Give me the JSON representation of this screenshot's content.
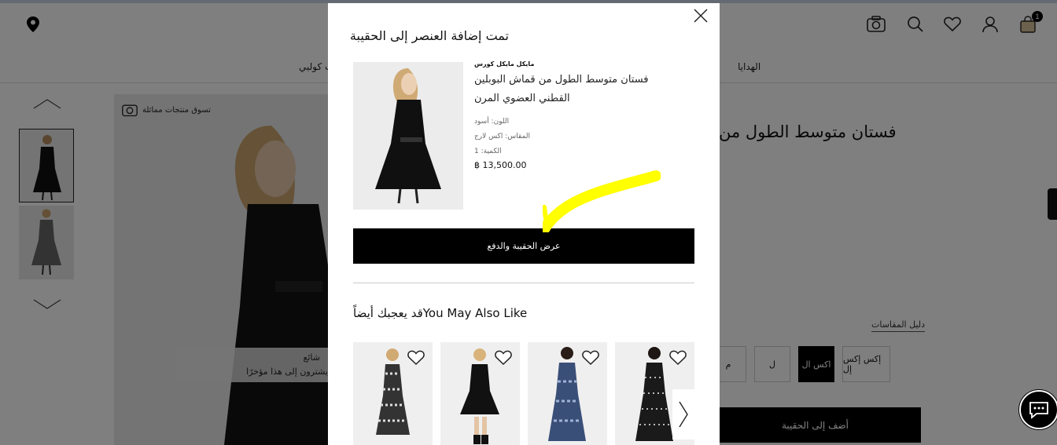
{
  "header": {
    "icons": [
      "location-icon",
      "visual-search-icon",
      "search-icon",
      "wishlist-icon",
      "account-icon",
      "bag-icon"
    ],
    "bag_count": "1"
  },
  "nav": {
    "items": [
      "الهدايا",
      "ب كولبي"
    ]
  },
  "gallery": {
    "shop_similar": "تسوق منتجات مماثلة",
    "trending_line1": "شائع",
    "trending_line2": "يشترون إلى هذا مؤخرًا"
  },
  "product_page": {
    "title": "فستان متوسط الطول من",
    "size_guide": "دليل المقاسات",
    "sizes": [
      "إكس إكس إل",
      "اكس ال",
      "ل",
      "م"
    ],
    "selected_size": "اكس ال",
    "add_to_bag": "أضف إلى الحقيبة"
  },
  "modal": {
    "title": "تمت إضافة العنصر إلى الحقيبة",
    "brand": "مايكل مايكل كورس",
    "product_name": "فستان متوسط الطول من قماش البوبلين القطني العضوي المرن",
    "color": "اللون: أسود",
    "size": "المقاس: اكس لارج",
    "quantity": "الكمية: 1",
    "price": "฿ 13,500.00",
    "checkout_button": "عرض الحقيبة والدفع",
    "you_may_also_like": "قد يعجبك أيضاًYou May Also Like"
  },
  "colors": {
    "accent": "#000000",
    "highlight": "#ffff00",
    "overlay": "rgba(0,0,0,0.5)"
  }
}
